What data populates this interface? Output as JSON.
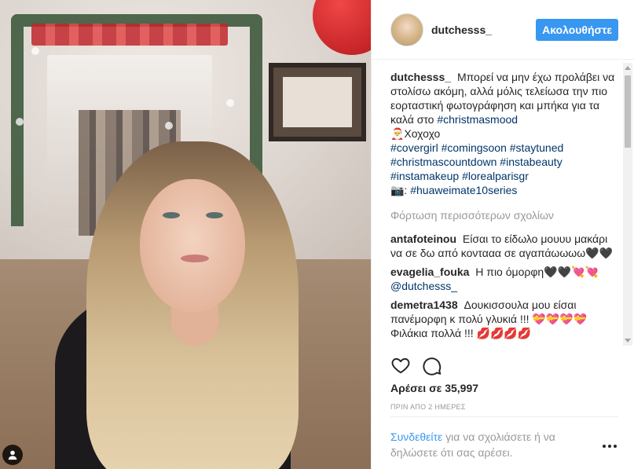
{
  "post": {
    "username": "dutchesss_",
    "follow_label": "Ακολουθήστε"
  },
  "caption": {
    "username": "dutchesss_",
    "text1": "Μπορεί να μην έχω προλάβει να στολίσω ακόμη, αλλά μόλις τελείωσα την πιο εορταστική φωτογράφηση και μπήκα για τα καλά στο",
    "tag1": "#christmasmood",
    "text2": "🎅Χοχοχο",
    "hashtags": [
      "#covergirl",
      "#comingsoon",
      "#staytuned",
      "#christmascountdown",
      "#instabeauty",
      "#instamakeup",
      "#lorealparisgr"
    ],
    "camera_prefix": "📷:",
    "camera_tag": "#huaweimate10series"
  },
  "load_more": "Φόρτωση περισσότερων σχολίων",
  "comments": [
    {
      "user": "antafoteinou",
      "text": "Είσαι το είδωλο μουυυ μακάρι να σε δω από κοντααα σε αγαπάωωωω🖤🖤"
    },
    {
      "user": "evagelia_fouka",
      "text": "Η πιο όμορφη🖤🖤💘💘",
      "mention": "@dutchesss_"
    },
    {
      "user": "demetra1438",
      "text": "Δουκισσουλα μου είσαι πανέμορφη κ πολύ γλυκιά !!! 💝💝💝💝 Φιλάκια πολλά !!! 💋💋💋💋"
    }
  ],
  "likes": "Αρέσει σε 35,997",
  "timestamp": "ΠΡΙΝ ΑΠΟ 2 ΗΜΕΡΕΣ",
  "login_prompt": {
    "link": "Συνδεθείτε",
    "rest": " για να σχολιάσετε ή να δηλώσετε ότι σας αρέσει."
  },
  "icons": {
    "like": "heart-icon",
    "comment": "comment-bubble-icon",
    "tag": "user-tag-icon",
    "options": "more-options-icon"
  },
  "colors": {
    "follow_button": "#3897f0",
    "hashtag": "#003569",
    "muted": "#999999"
  }
}
